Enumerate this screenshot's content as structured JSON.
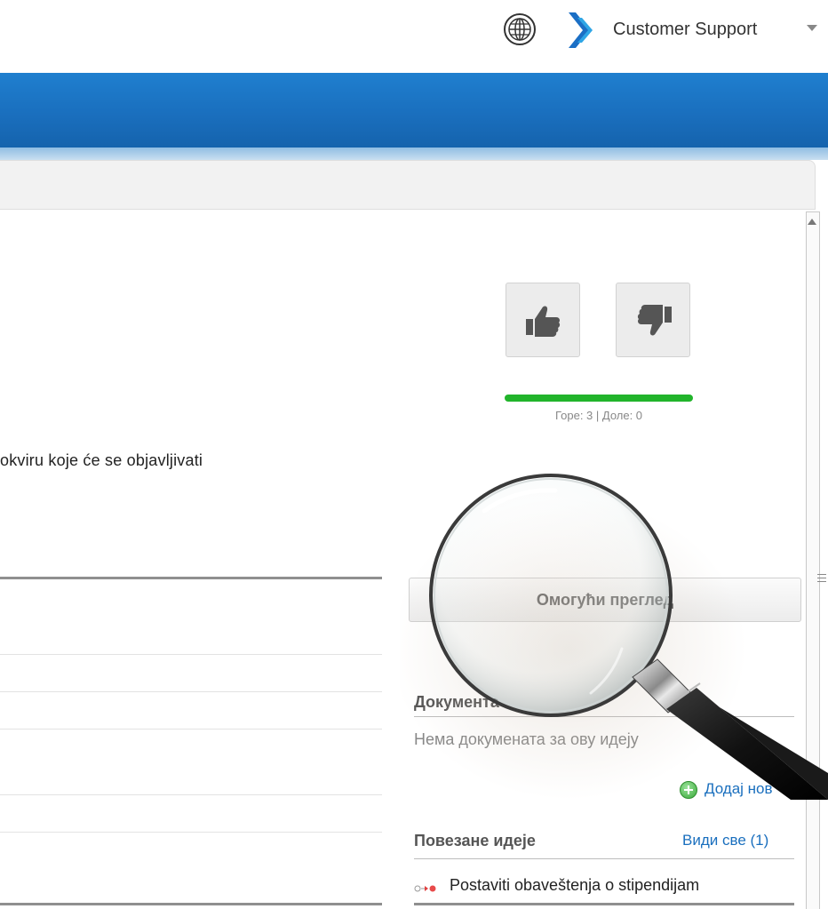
{
  "header": {
    "user_menu_label": "Customer Support"
  },
  "main": {
    "description_fragment": "okviru koje će se objavljivati"
  },
  "voting": {
    "up_count_text": "Горе: 3 | Доле: 0",
    "up_votes": 3,
    "down_votes": 0,
    "up_share": 1.0
  },
  "preview": {
    "button_label": "Омогући преглед"
  },
  "documents": {
    "title": "Документа",
    "empty_text": "Нема докумената за ову идеју",
    "add_new_label": "Додај нов"
  },
  "related_ideas": {
    "title": "Повезане идеје",
    "see_all_label": "Види све (1)",
    "items": [
      {
        "label": "Postaviti obaveštenja o stipendijam"
      }
    ]
  },
  "colors": {
    "header_blue": "#1a6fbe",
    "vote_bar_green": "#21b42b",
    "link_blue": "#1a6fbe"
  },
  "icons": {
    "language": "globe-icon",
    "brand": "brand-logo-icon",
    "vote_up": "thumbs-up-icon",
    "vote_down": "thumbs-down-icon",
    "add": "plus-circle-icon",
    "magnifier": "magnifying-glass-icon"
  }
}
